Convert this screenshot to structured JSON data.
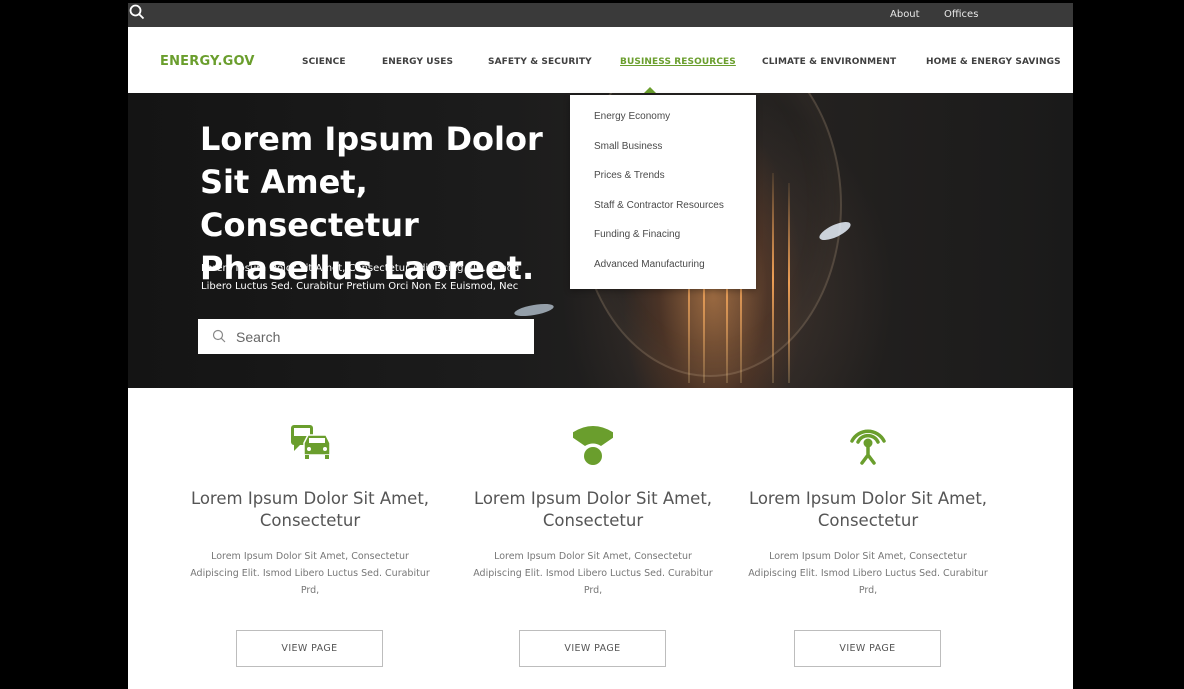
{
  "utility_bar": {
    "about": "About",
    "offices": "Offices"
  },
  "header": {
    "logo": "ENERGY.GOV",
    "nav": [
      "SCIENCE",
      "ENERGY USES",
      "SAFETY & SECURITY",
      "BUSINESS RESOURCES",
      "CLIMATE & ENVIRONMENT",
      "HOME & ENERGY SAVINGS"
    ],
    "active_index": 3
  },
  "dropdown": {
    "items": [
      "Energy  Economy",
      "Small Business",
      "Prices & Trends",
      "Staff & Contractor Resources",
      "Funding & Finacing",
      "Advanced Manufacturing"
    ]
  },
  "hero": {
    "title": "Lorem Ipsum Dolor Sit Amet, Consectetur Phasellus Laoreet.",
    "subtitle": "Lorem Ipsum Dolor Sit Amet, Consectetur Adipiscing Elit. Ismod Libero Luctus Sed. Curabitur Pretium Orci Non Ex Euismod, Nec",
    "search_placeholder": "Search"
  },
  "features": [
    {
      "icon": "bus-car-icon",
      "title": "Lorem Ipsum Dolor Sit Amet, Consectetur",
      "text": "Lorem Ipsum Dolor Sit Amet, Consectetur Adipiscing Elit. Ismod Libero Luctus Sed. Curabitur Prd,",
      "button": "VIEW PAGE"
    },
    {
      "icon": "wifi-signal-icon",
      "title": "Lorem Ipsum Dolor Sit Amet, Consectetur",
      "text": "Lorem Ipsum Dolor Sit Amet, Consectetur Adipiscing Elit. Ismod Libero Luctus Sed. Curabitur Prd,",
      "button": "VIEW PAGE"
    },
    {
      "icon": "broadcast-tower-icon",
      "title": "Lorem Ipsum Dolor Sit Amet, Consectetur",
      "text": "Lorem Ipsum Dolor Sit Amet, Consectetur Adipiscing Elit. Ismod Libero Luctus Sed. Curabitur Prd,",
      "button": "VIEW PAGE"
    }
  ],
  "colors": {
    "accent": "#6a9e2d",
    "utility_bar": "#3a3a3a",
    "frame": "#000000"
  }
}
